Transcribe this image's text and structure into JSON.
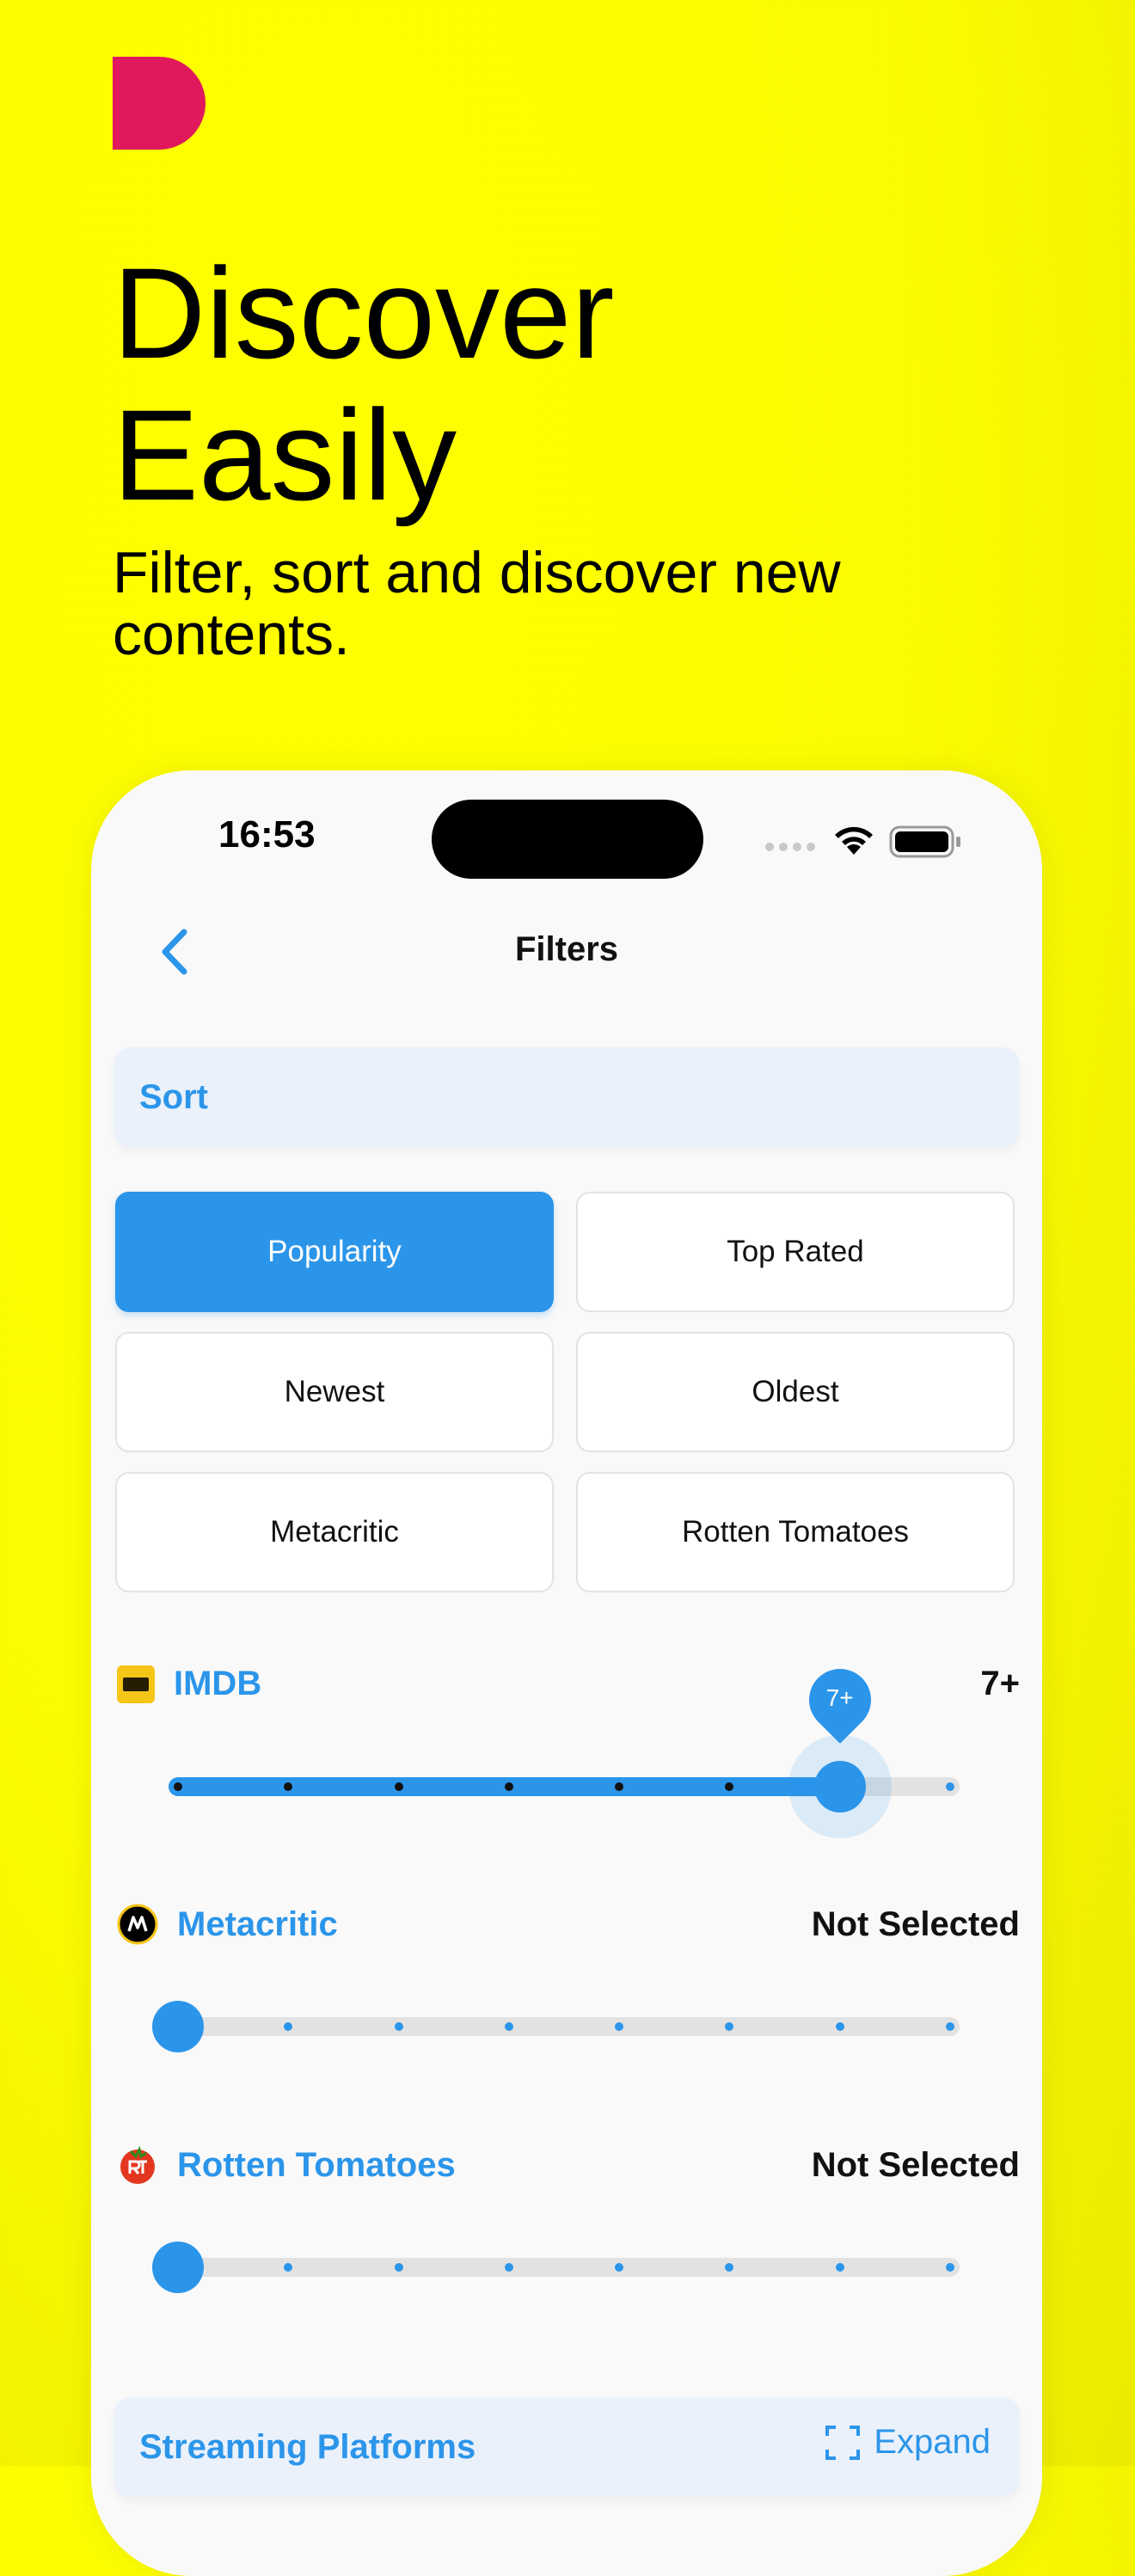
{
  "promo": {
    "headline_line1": "Discover",
    "headline_line2": "Easily",
    "subtitle": "Filter, sort and discover new contents."
  },
  "status_bar": {
    "time": "16:53"
  },
  "nav": {
    "title": "Filters",
    "back_icon": "chevron-left-icon"
  },
  "sort_section": {
    "title": "Sort",
    "options": [
      "Popularity",
      "Top Rated",
      "Newest",
      "Oldest",
      "Metacritic",
      "Rotten Tomatoes"
    ],
    "selected": "Popularity"
  },
  "filters": [
    {
      "name": "IMDB",
      "icon": "imdb-icon",
      "value_text": "7+",
      "badge": "7+",
      "level": 7,
      "min": 1,
      "max": 8
    },
    {
      "name": "Metacritic",
      "icon": "metacritic-icon",
      "value_text": "Not Selected",
      "level": 1,
      "min": 1,
      "max": 8
    },
    {
      "name": "Rotten Tomatoes",
      "icon": "rotten-tomatoes-icon",
      "value_text": "Not Selected",
      "level": 1,
      "min": 1,
      "max": 8
    }
  ],
  "platforms_section": {
    "title": "Streaming Platforms",
    "expand_label": "Expand",
    "expand_icon": "expand-icon"
  },
  "colors": {
    "background": "#FFFF00",
    "accent": "#2B95EA",
    "logo": "#E0195C"
  }
}
